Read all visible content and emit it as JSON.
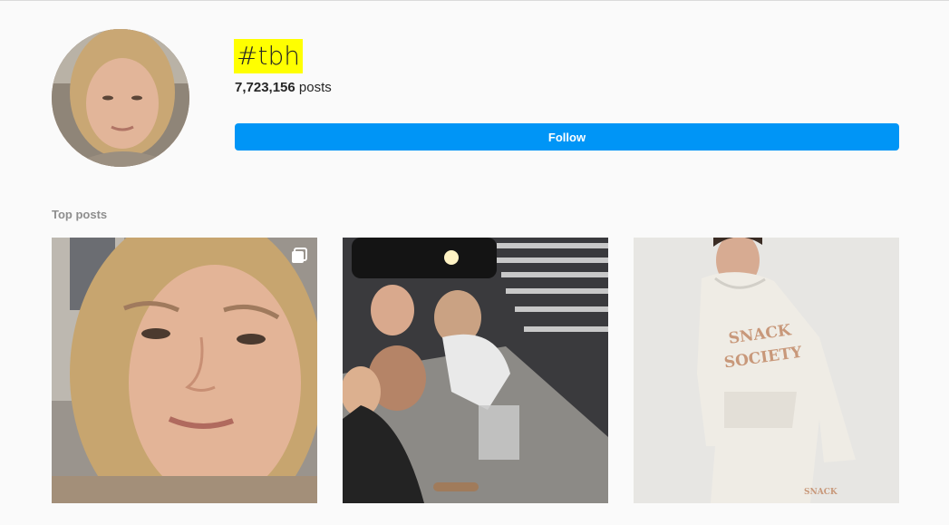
{
  "hashtag": {
    "name": "#tbh",
    "post_count": "7,723,156",
    "post_count_suffix": "posts",
    "highlight_color": "#ffff00"
  },
  "follow_button": {
    "label": "Follow",
    "color": "#0095f6"
  },
  "top_posts": {
    "title": "Top posts",
    "items": [
      {
        "name": "post-1",
        "subject": "woman-face-closeup",
        "multiple_images": true,
        "icon": "carousel-icon"
      },
      {
        "name": "post-2",
        "subject": "group-selfie-at-night",
        "multiple_images": false
      },
      {
        "name": "post-3",
        "subject": "man-in-white-hoodie",
        "multiple_images": false,
        "hoodie_text": "SNACK SOCIETY",
        "pants_text": "SNACK SOCI"
      }
    ]
  }
}
